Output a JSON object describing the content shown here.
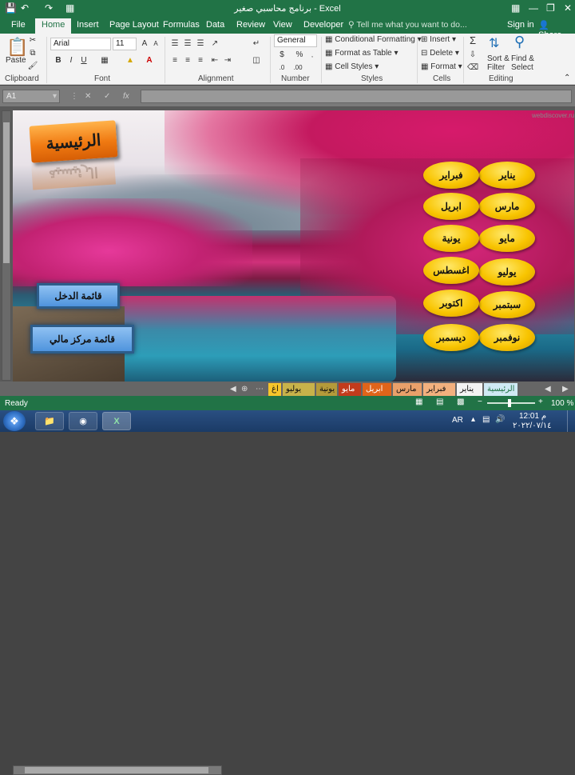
{
  "window": {
    "title": "برنامج محاسبي صغير - Excel",
    "controls": [
      "—",
      "❐",
      "✕"
    ]
  },
  "ribbon_tabs": [
    "File",
    "Home",
    "Insert",
    "Page Layout",
    "Formulas",
    "Data",
    "Review",
    "View",
    "Developer"
  ],
  "active_tab": "Home",
  "tell_me": "Tell me what you want to do...",
  "account": {
    "sign_in": "Sign in",
    "share": "Share"
  },
  "ribbon": {
    "clipboard": {
      "label": "Clipboard",
      "paste": "Paste"
    },
    "font": {
      "label": "Font",
      "name": "Arial",
      "size": "11"
    },
    "alignment": {
      "label": "Alignment"
    },
    "number": {
      "label": "Number",
      "format": "General",
      "percent": "%"
    },
    "styles": {
      "label": "Styles",
      "conditional": "Conditional Formatting",
      "format_table": "Format as Table",
      "cell_styles": "Cell Styles"
    },
    "cells": {
      "label": "Cells",
      "insert": "Insert",
      "delete": "Delete",
      "format": "Format"
    },
    "editing": {
      "label": "Editing",
      "sort": "Sort &",
      "filter": "Filter",
      "find": "Find &",
      "select": "Select"
    }
  },
  "formula_bar": {
    "name_box": "A1",
    "fx": "fx",
    "value": ""
  },
  "dashboard": {
    "title": "الرئيسية",
    "income_list": "قائمة الدخل",
    "financial_position": "قائمة مركز مالي",
    "months": [
      "يناير",
      "فبراير",
      "مارس",
      "ابريل",
      "مايو",
      "يونية",
      "يوليو",
      "اغسطس",
      "سبتمبر",
      "اكتوبر",
      "نوفمبر",
      "ديسمبر"
    ],
    "watermark": "webdiscover.ru"
  },
  "sheet_tabs": [
    "الرئيسية",
    "يناير",
    "فبراير",
    "مارس",
    "ابريل",
    "مايو",
    "يونية",
    "يوليو",
    "اغ"
  ],
  "status": {
    "ready": "Ready",
    "zoom": "100 %"
  },
  "taskbar": {
    "lang": "AR",
    "time": "12:01 م",
    "date": "٢٠٢٢/٠٧/١٤"
  }
}
